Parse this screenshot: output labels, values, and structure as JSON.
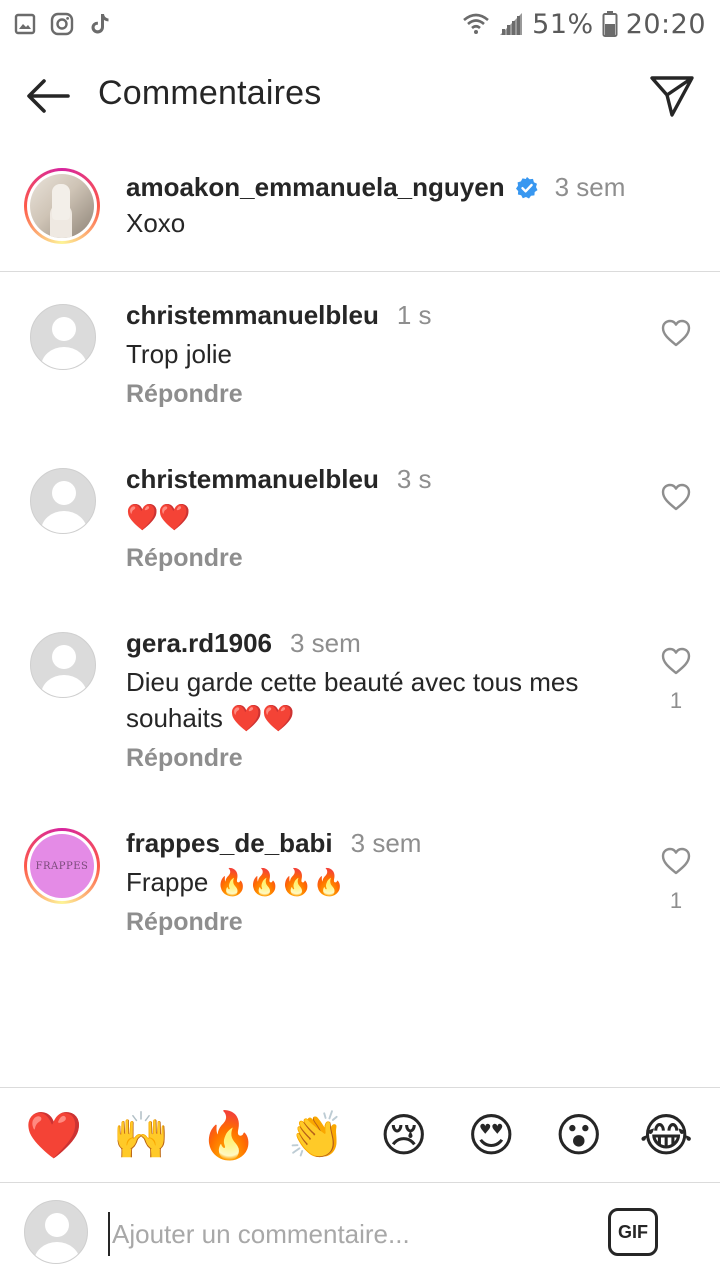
{
  "status_bar": {
    "battery": "51%",
    "time": "20:20"
  },
  "header": {
    "title": "Commentaires"
  },
  "caption": {
    "username": "amoakon_emmanuela_nguyen",
    "time": "3 sem",
    "text": "Xoxo"
  },
  "comments": [
    {
      "username": "christemmanuelbleu",
      "time": "1 s",
      "text": "Trop jolie",
      "reply": "Répondre",
      "likes": ""
    },
    {
      "username": "christemmanuelbleu",
      "time": "3 s",
      "text": "❤️❤️",
      "reply": "Répondre",
      "likes": ""
    },
    {
      "username": "gera.rd1906",
      "time": "3 sem",
      "text": "Dieu garde cette beauté avec tous mes souhaits ❤️❤️",
      "reply": "Répondre",
      "likes": "1"
    },
    {
      "username": "frappes_de_babi",
      "time": "3 sem",
      "text": "Frappe 🔥🔥🔥🔥",
      "reply": "Répondre",
      "likes": "1",
      "avatar_text": "FRAPPES"
    }
  ],
  "emoji_bar": [
    "❤️",
    "🙌",
    "🔥",
    "👏",
    "😢",
    "😍",
    "😮",
    "😂"
  ],
  "input": {
    "placeholder": "Ajouter un commentaire...",
    "gif_label": "GIF"
  },
  "colors": {
    "text": "#262626",
    "secondary": "#8e8e8e",
    "verified": "#3897f0",
    "divider": "#dbdbdb"
  }
}
